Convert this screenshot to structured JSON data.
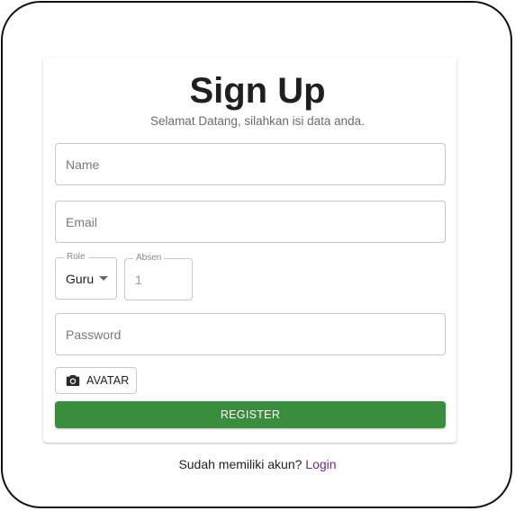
{
  "form": {
    "title": "Sign Up",
    "subtitle": "Selamat Datang, silahkan isi data anda.",
    "name_placeholder": "Name",
    "email_placeholder": "Email",
    "role": {
      "label": "Role",
      "value": "Guru"
    },
    "absen": {
      "label": "Absen",
      "placeholder": "1"
    },
    "password_placeholder": "Password",
    "avatar_label": "AVATAR",
    "avatar_icon": "camera-icon",
    "register_label": "REGISTER",
    "register_color": "#388e3c"
  },
  "footer": {
    "prompt": "Sudah memiliki akun?",
    "login_link": "Login",
    "link_color": "#6a2c8e"
  }
}
